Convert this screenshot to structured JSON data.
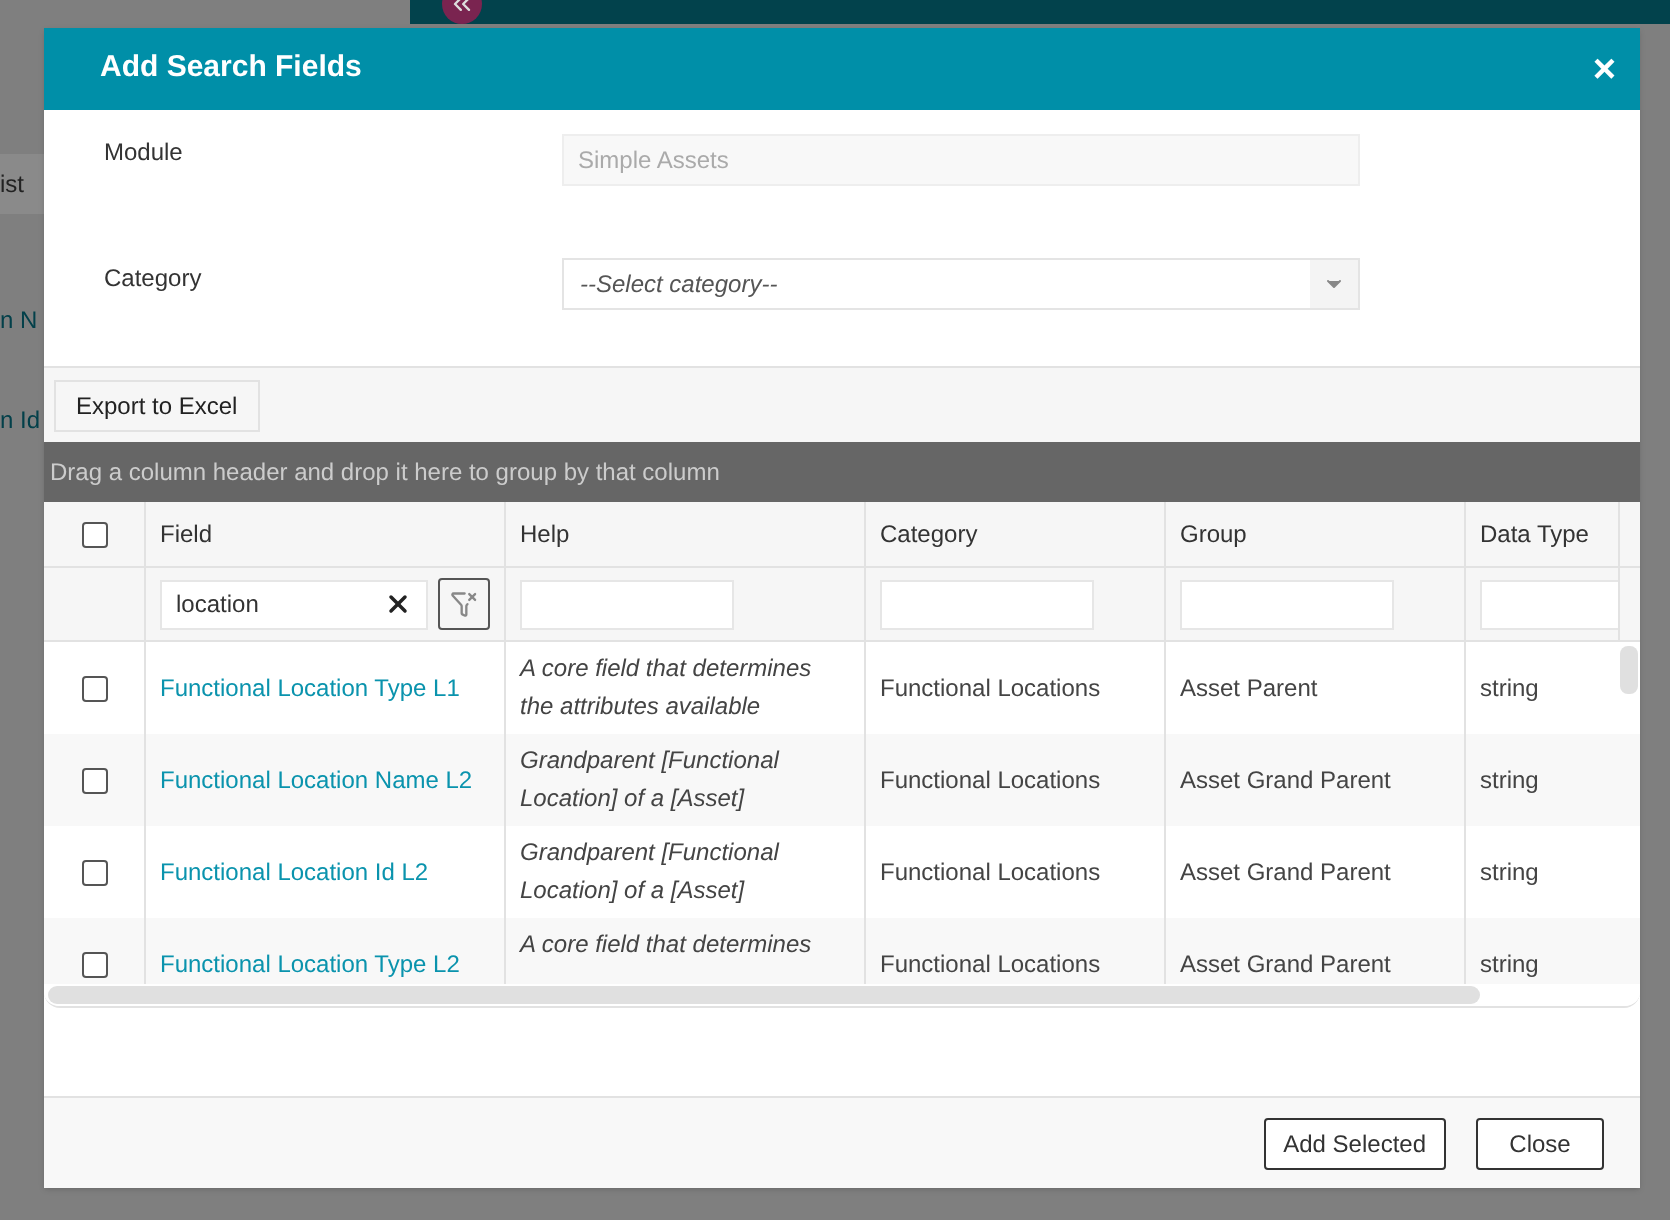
{
  "background": {
    "fragments": [
      "ist",
      "n N",
      "n Id"
    ]
  },
  "dialog": {
    "title": "Add Search Fields",
    "close": "×",
    "module": {
      "label": "Module",
      "value": "Simple Assets",
      "disabled": true
    },
    "category": {
      "label": "Category",
      "placeholder": "--Select category--"
    },
    "grid": {
      "toolbar_button": "Export to Excel",
      "group_hint": "Drag a column header and drop it here to group by that column",
      "columns": [
        {
          "label": "Field",
          "filter": "location"
        },
        {
          "label": "Help"
        },
        {
          "label": "Category"
        },
        {
          "label": "Group"
        },
        {
          "label": "Data Type"
        }
      ],
      "select_all": {
        "checked": false
      },
      "rows": [
        {
          "checked": false,
          "field": "Functional Location Type L1",
          "help": "A core field that determines the attributes available",
          "category": "Functional Locations",
          "group": "Asset Parent",
          "data_type": "string"
        },
        {
          "checked": false,
          "field": "Functional Location Name L2",
          "help": "Grandparent [Functional Location] of a [Asset]",
          "category": "Functional Locations",
          "group": "Asset Grand Parent",
          "data_type": "string"
        },
        {
          "checked": false,
          "field": "Functional Location Id L2",
          "help": "Grandparent [Functional Location] of a [Asset]",
          "category": "Functional Locations",
          "group": "Asset Grand Parent",
          "data_type": "string"
        },
        {
          "checked": false,
          "field": "Functional Location Type L2",
          "help": "A core field that determines",
          "category": "Functional Locations",
          "group": "Asset Grand Parent",
          "data_type": "string"
        }
      ]
    },
    "buttons": [
      "Add Selected",
      "Close"
    ]
  }
}
